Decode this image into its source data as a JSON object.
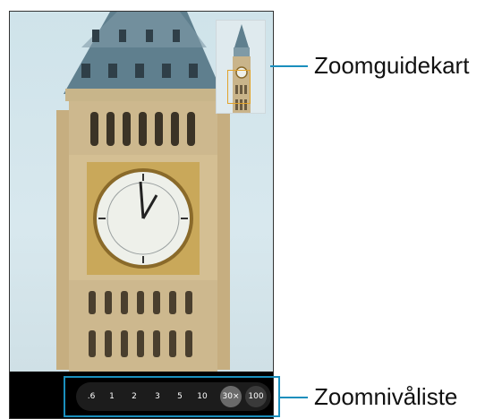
{
  "labels": {
    "guide_map": "Zoomguidekart",
    "zoom_list": "Zoomnivåliste"
  },
  "zoom_levels": [
    ".6",
    "1",
    "2",
    "3",
    "5",
    "10",
    "30×",
    "100"
  ],
  "active_zoom": "30×",
  "colors": {
    "callout": "#1a8fbd",
    "guide_frame": "#e2a32a"
  }
}
